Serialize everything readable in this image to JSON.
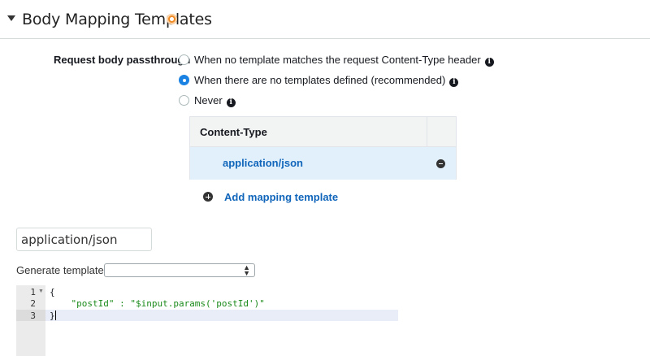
{
  "section": {
    "title": "Body Mapping Templates"
  },
  "passthrough": {
    "label": "Request body passthrough",
    "options": [
      {
        "label": "When no template matches the request Content-Type header",
        "selected": false
      },
      {
        "label": "When there are no templates defined (recommended)",
        "selected": true
      },
      {
        "label": "Never",
        "selected": false
      }
    ]
  },
  "content_type_table": {
    "header": "Content-Type",
    "rows": [
      "application/json"
    ]
  },
  "add_mapping_label": "Add mapping template",
  "template_name": "application/json",
  "generate": {
    "label": "Generate template:",
    "selected": ""
  },
  "editor": {
    "lines": [
      {
        "num": "1",
        "text": "{"
      },
      {
        "num": "2",
        "text": "    \"postId\" : \"$input.params('postId')\""
      },
      {
        "num": "3",
        "text": "}"
      }
    ],
    "active_line": 3
  },
  "colors": {
    "accent_link": "#1166bb",
    "info_badge": "#f08a24",
    "selected_row": "#e1f0fb",
    "radio_selected": "#1a82e2"
  }
}
